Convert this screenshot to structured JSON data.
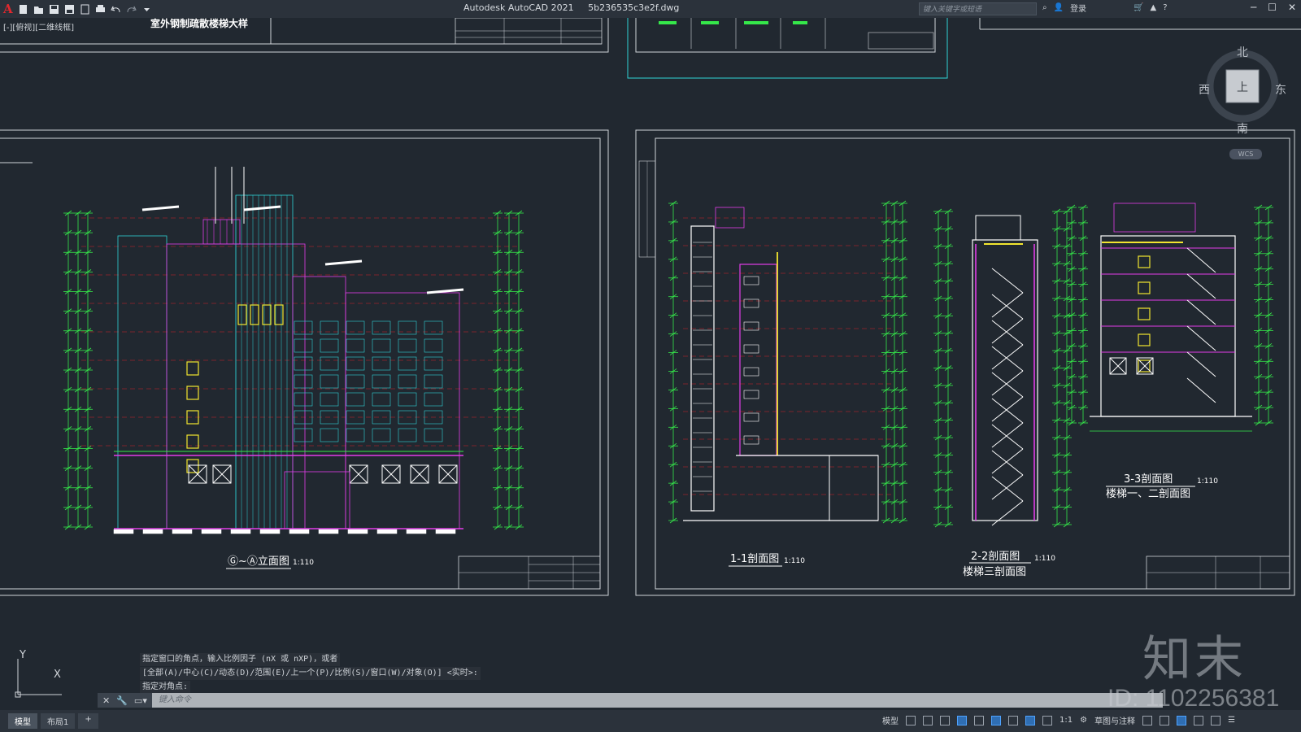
{
  "titlebar": {
    "app_name": "Autodesk AutoCAD 2021",
    "file_name": "5b236535c3e2f.dwg",
    "search_placeholder": "键入关键字或短语",
    "login_label": "登录"
  },
  "viewport": {
    "view_label": "[-][俯视][二维线框]",
    "top_sheet_title": "室外钢制疏散楼梯大样"
  },
  "drawings": {
    "elevation_title": "Ⓖ~Ⓐ立面图",
    "elevation_scale": "1:110",
    "section11_title": "1-1剖面图",
    "section11_scale": "1:110",
    "section22_title": "2-2剖面图",
    "section22_scale": "1:110",
    "section22_sub": "楼梯三剖面图",
    "section33_title": "3-3剖面图",
    "section33_scale": "1:110",
    "section33_sub": "楼梯一、二剖面图"
  },
  "navcube": {
    "north": "北",
    "south": "南",
    "east": "东",
    "west": "西",
    "face": "上",
    "wcs": "WCS"
  },
  "command": {
    "history": [
      "指定窗口的角点，输入比例因子 (nX 或 nXP)，或者",
      "[全部(A)/中心(C)/动态(D)/范围(E)/上一个(P)/比例(S)/窗口(W)/对象(O)] <实时>:",
      "指定对角点:"
    ],
    "input_placeholder": "键入命令"
  },
  "statusbar": {
    "tabs": [
      "模型",
      "布局1",
      "+"
    ],
    "model_label": "模型",
    "scale_label": "1:1",
    "workspace_label": "草图与注释"
  },
  "ucs": {
    "x": "X",
    "y": "Y"
  },
  "watermark": {
    "logo": "知末",
    "id": "ID: 1102256381"
  },
  "colors": {
    "background": "#212830",
    "green": "#35e84a",
    "magenta": "#e23ce8",
    "yellow": "#f2e62f",
    "red": "#d8232a",
    "cyan": "#2fd3d6"
  }
}
